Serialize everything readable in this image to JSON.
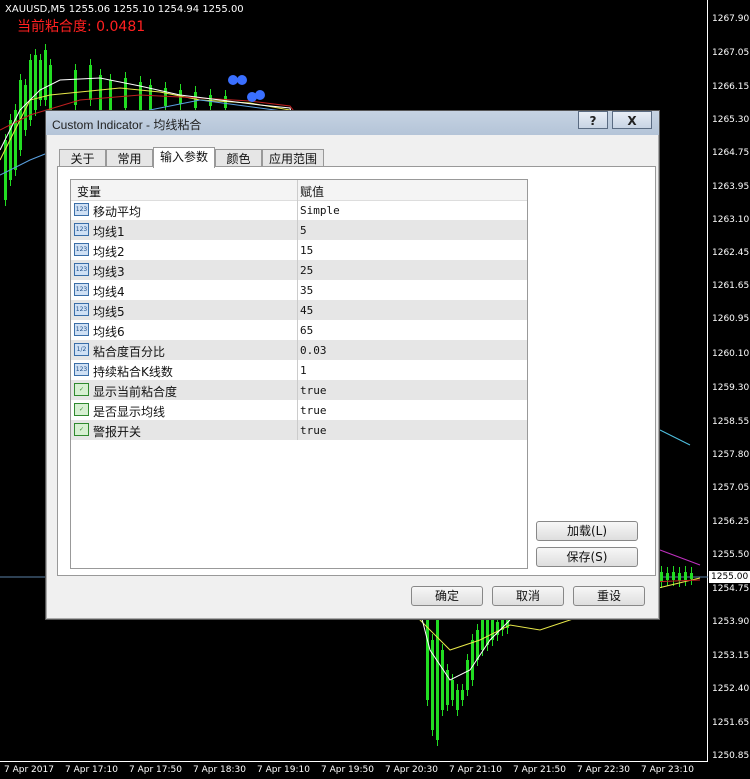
{
  "chart": {
    "symbol_info": "XAUUSD,M5  1255.06 1255.10 1254.94 1255.00",
    "stickiness_label": "当前粘合度: 0.0481",
    "current_price": "1255.00",
    "price_labels": [
      "1267.90",
      "1267.05",
      "1266.15",
      "1265.30",
      "1264.75",
      "1263.95",
      "1263.10",
      "1262.45",
      "1261.65",
      "1260.95",
      "1260.10",
      "1259.30",
      "1258.55",
      "1257.80",
      "1257.05",
      "1256.25",
      "1255.50",
      "1254.75",
      "1253.90",
      "1253.15",
      "1252.40",
      "1251.65",
      "1250.85"
    ],
    "time_labels": [
      "7 Apr 2017",
      "7 Apr 17:10",
      "7 Apr 17:50",
      "7 Apr 18:30",
      "7 Apr 19:10",
      "7 Apr 19:50",
      "7 Apr 20:30",
      "7 Apr 21:10",
      "7 Apr 21:50",
      "7 Apr 22:30",
      "7 Apr 23:10"
    ]
  },
  "dialog": {
    "title": "Custom Indicator - 均线粘合",
    "help_label": "?",
    "close_label": "X",
    "tabs": [
      "关于",
      "常用",
      "输入参数",
      "颜色",
      "应用范围"
    ],
    "active_tab": "输入参数",
    "grid": {
      "col_variable": "变量",
      "col_value": "赋值",
      "rows": [
        {
          "name": "移动平均",
          "value": "Simple",
          "icon": "123"
        },
        {
          "name": "均线1",
          "value": "5",
          "icon": "123"
        },
        {
          "name": "均线2",
          "value": "15",
          "icon": "123"
        },
        {
          "name": "均线3",
          "value": "25",
          "icon": "123"
        },
        {
          "name": "均线4",
          "value": "35",
          "icon": "123"
        },
        {
          "name": "均线5",
          "value": "45",
          "icon": "123"
        },
        {
          "name": "均线6",
          "value": "65",
          "icon": "123"
        },
        {
          "name": "粘合度百分比",
          "value": "0.03",
          "icon": "1/2"
        },
        {
          "name": "持续粘合K线数",
          "value": "1",
          "icon": "123"
        },
        {
          "name": "显示当前粘合度",
          "value": "true",
          "icon": "bool"
        },
        {
          "name": "是否显示均线",
          "value": "true",
          "icon": "bool"
        },
        {
          "name": "警报开关",
          "value": "true",
          "icon": "bool"
        }
      ]
    },
    "load_button": "加载(L)",
    "save_button": "保存(S)",
    "ok_button": "确定",
    "cancel_button": "取消",
    "reset_button": "重设"
  },
  "colors": {
    "bull_candle": "#22dd22",
    "ma_yellow": "#e8e84a",
    "ma_red": "#c02020",
    "ma_blue": "#3a6fff",
    "stick_text": "#ff2020"
  }
}
